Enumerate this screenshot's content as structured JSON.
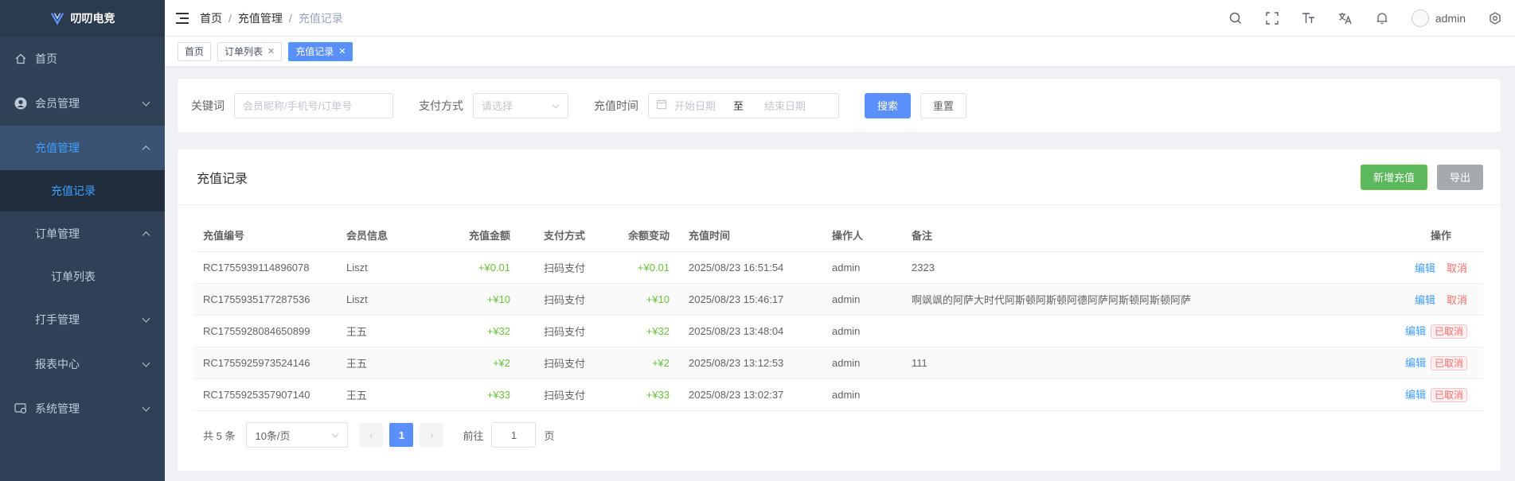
{
  "app": {
    "title": "叨叨电竞"
  },
  "sidebar": {
    "items": [
      {
        "label": "首页",
        "icon": "home-icon"
      },
      {
        "label": "会员管理",
        "icon": "user-circle-icon"
      },
      {
        "label": "充值管理"
      },
      {
        "label": "充值记录"
      },
      {
        "label": "订单管理"
      },
      {
        "label": "订单列表"
      },
      {
        "label": "打手管理"
      },
      {
        "label": "报表中心"
      },
      {
        "label": "系统管理",
        "icon": "settings-icon"
      }
    ]
  },
  "header": {
    "breadcrumb": [
      "首页",
      "充值管理",
      "充值记录"
    ],
    "user": "admin"
  },
  "tags": [
    {
      "label": "首页"
    },
    {
      "label": "订单列表"
    },
    {
      "label": "充值记录"
    }
  ],
  "search": {
    "keyword_label": "关键词",
    "keyword_placeholder": "会员昵称/手机号/订单号",
    "pay_label": "支付方式",
    "pay_placeholder": "请选择",
    "time_label": "充值时间",
    "start_placeholder": "开始日期",
    "range_sep": "至",
    "end_placeholder": "结束日期",
    "search_button": "搜索",
    "reset_button": "重置"
  },
  "table": {
    "title": "充值记录",
    "add_button": "新增充值",
    "export_button": "导出",
    "columns": [
      "充值编号",
      "会员信息",
      "充值金额",
      "支付方式",
      "余额变动",
      "充值时间",
      "操作人",
      "备注",
      "操作"
    ],
    "rows": [
      {
        "id": "RC1755939114896078",
        "member": "Liszt",
        "amount": "+¥0.01",
        "pay": "扫码支付",
        "change": "+¥0.01",
        "time": "2025/08/23 16:51:54",
        "operator": "admin",
        "remark": "2323",
        "edit": "编辑",
        "action": "取消",
        "cancelled": false
      },
      {
        "id": "RC1755935177287536",
        "member": "Liszt",
        "amount": "+¥10",
        "pay": "扫码支付",
        "change": "+¥10",
        "time": "2025/08/23 15:46:17",
        "operator": "admin",
        "remark": "啊飒飒的阿萨大时代阿斯顿阿斯顿阿德阿萨阿斯顿阿斯顿阿萨",
        "edit": "编辑",
        "action": "取消",
        "cancelled": false
      },
      {
        "id": "RC1755928084650899",
        "member": "王五",
        "amount": "+¥32",
        "pay": "扫码支付",
        "change": "+¥32",
        "time": "2025/08/23 13:48:04",
        "operator": "admin",
        "remark": "",
        "edit": "编辑",
        "action": "已取消",
        "cancelled": true
      },
      {
        "id": "RC1755925973524146",
        "member": "王五",
        "amount": "+¥2",
        "pay": "扫码支付",
        "change": "+¥2",
        "time": "2025/08/23 13:12:53",
        "operator": "admin",
        "remark": "111",
        "edit": "编辑",
        "action": "已取消",
        "cancelled": true
      },
      {
        "id": "RC1755925357907140",
        "member": "王五",
        "amount": "+¥33",
        "pay": "扫码支付",
        "change": "+¥33",
        "time": "2025/08/23 13:02:37",
        "operator": "admin",
        "remark": "",
        "edit": "编辑",
        "action": "已取消",
        "cancelled": true
      }
    ]
  },
  "pagination": {
    "total_text": "共 5 条",
    "page_size": "10条/页",
    "current_page": "1",
    "goto_label": "前往",
    "goto_value": "1",
    "page_suffix": "页"
  }
}
